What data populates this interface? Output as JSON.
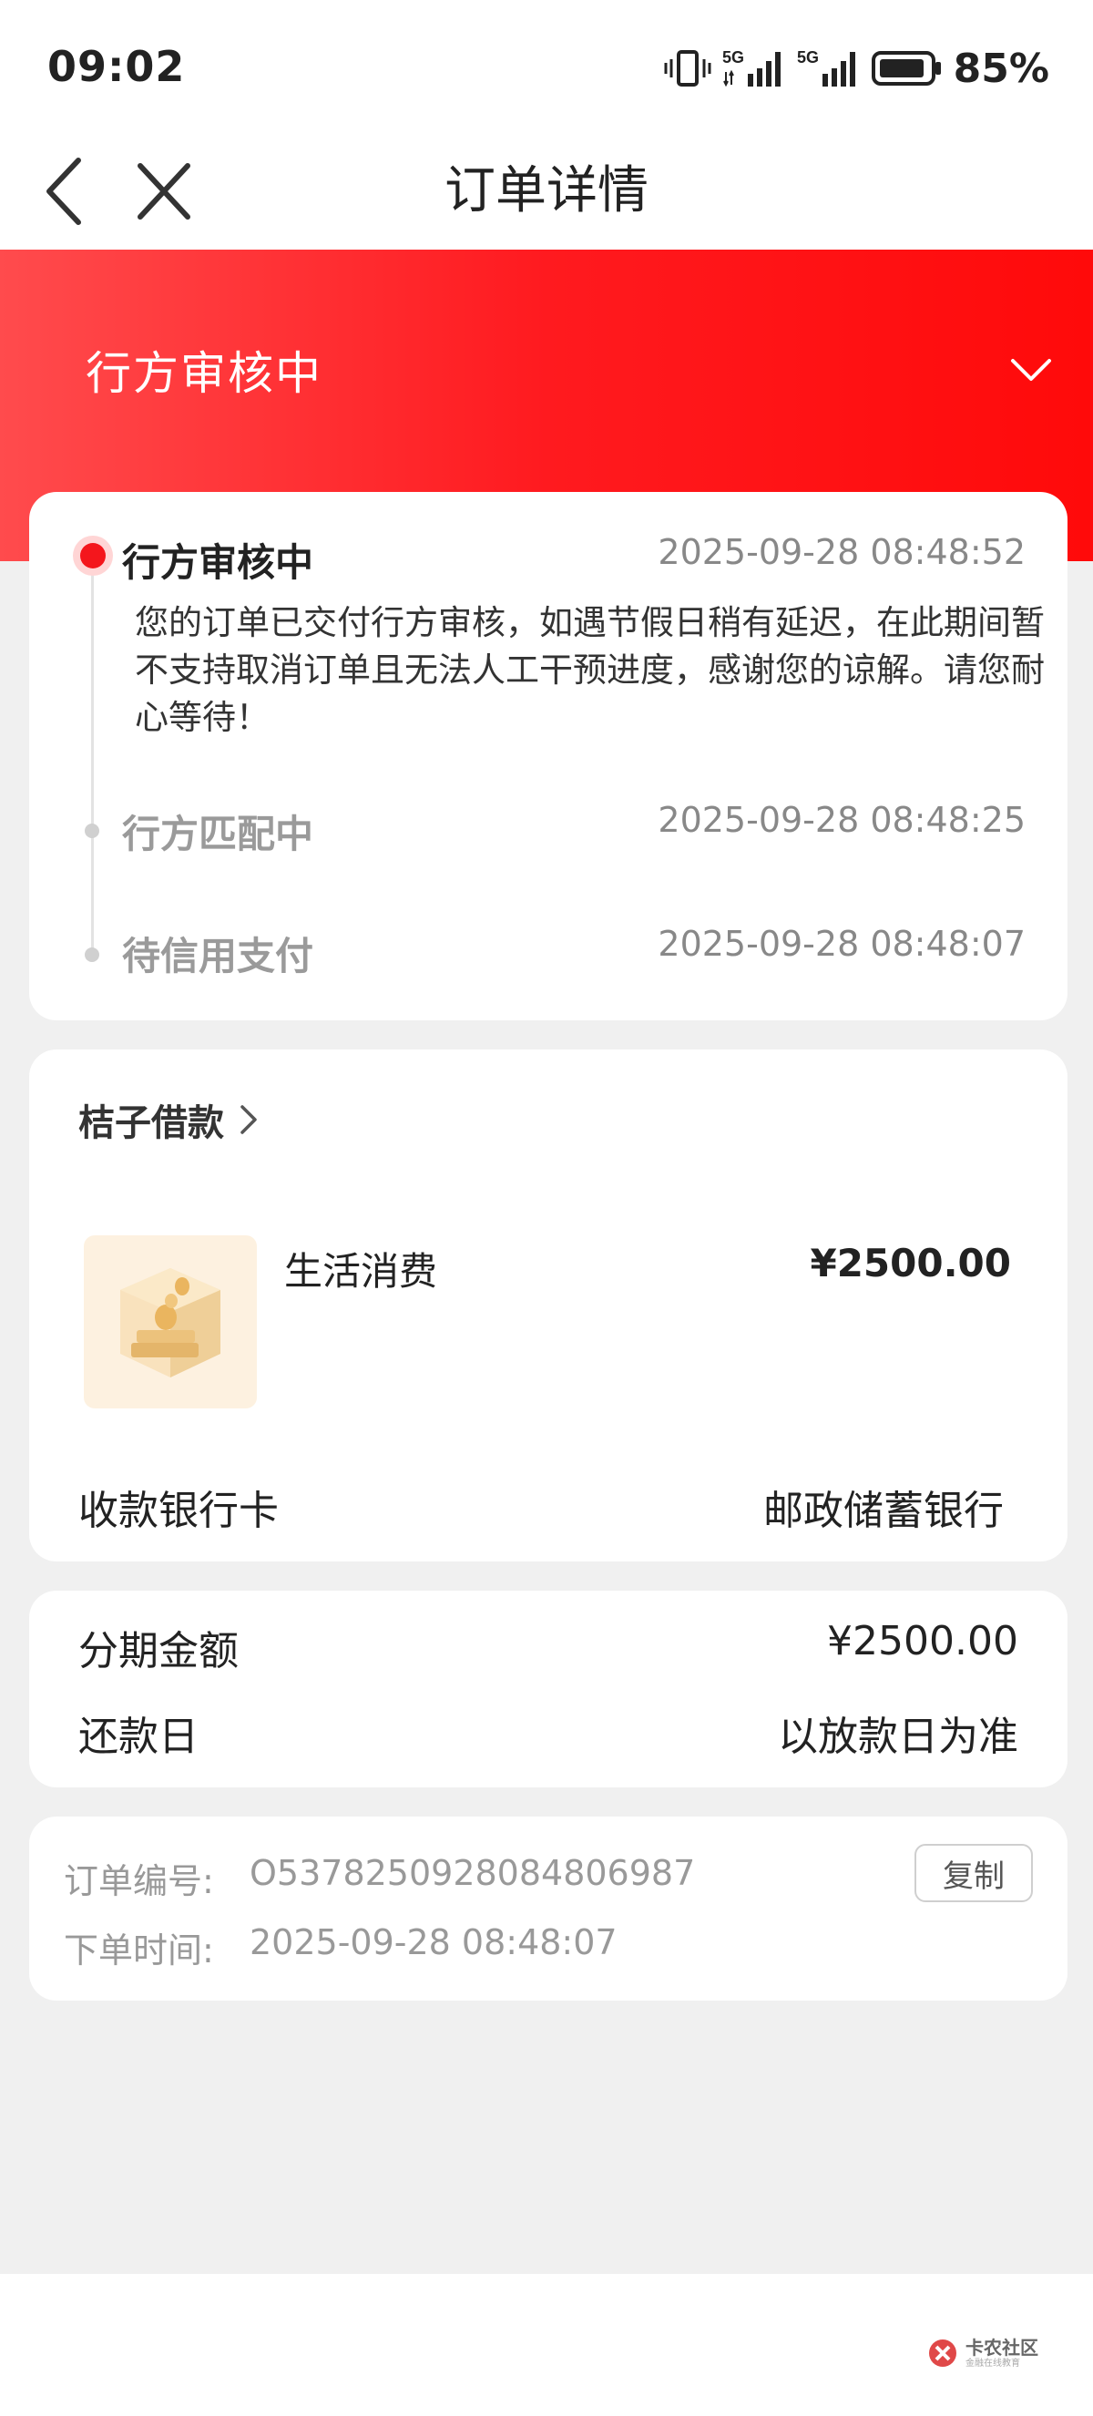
{
  "status_bar": {
    "time": "09:02",
    "signal1_label": "5G",
    "signal2_label": "5G",
    "battery_percent": "85%"
  },
  "nav": {
    "title": "订单详情"
  },
  "header": {
    "status": "行方审核中"
  },
  "timeline": {
    "steps": [
      {
        "title": "行方审核中",
        "time": "2025-09-28 08:48:52",
        "description": "您的订单已交付行方审核，如遇节假日稍有延迟，在此期间暂不支持取消订单且无法人工干预进度，感谢您的谅解。请您耐心等待！",
        "active": true
      },
      {
        "title": "行方匹配中",
        "time": "2025-09-28 08:48:25",
        "active": false
      },
      {
        "title": "待信用支付",
        "time": "2025-09-28 08:48:07",
        "active": false
      }
    ]
  },
  "product": {
    "merchant": "桔子借款",
    "name": "生活消费",
    "price": "¥2500.00",
    "bank_label": "收款银行卡",
    "bank_value": "邮政储蓄银行"
  },
  "amount": {
    "installment_label": "分期金额",
    "installment_value": "¥2500.00",
    "repay_label": "还款日",
    "repay_value": "以放款日为准"
  },
  "order": {
    "number_label": "订单编号:",
    "number_value": "O5378250928084806987",
    "copy_label": "复制",
    "time_label": "下单时间:",
    "time_value": "2025-09-28 08:48:07"
  },
  "watermark": {
    "main": "卡农社区",
    "sub": "金融在线教育"
  },
  "colors": {
    "accent_red": "#f4161c",
    "header_gradient_start": "#ff4b4d",
    "header_gradient_end": "#ff0a0a"
  }
}
